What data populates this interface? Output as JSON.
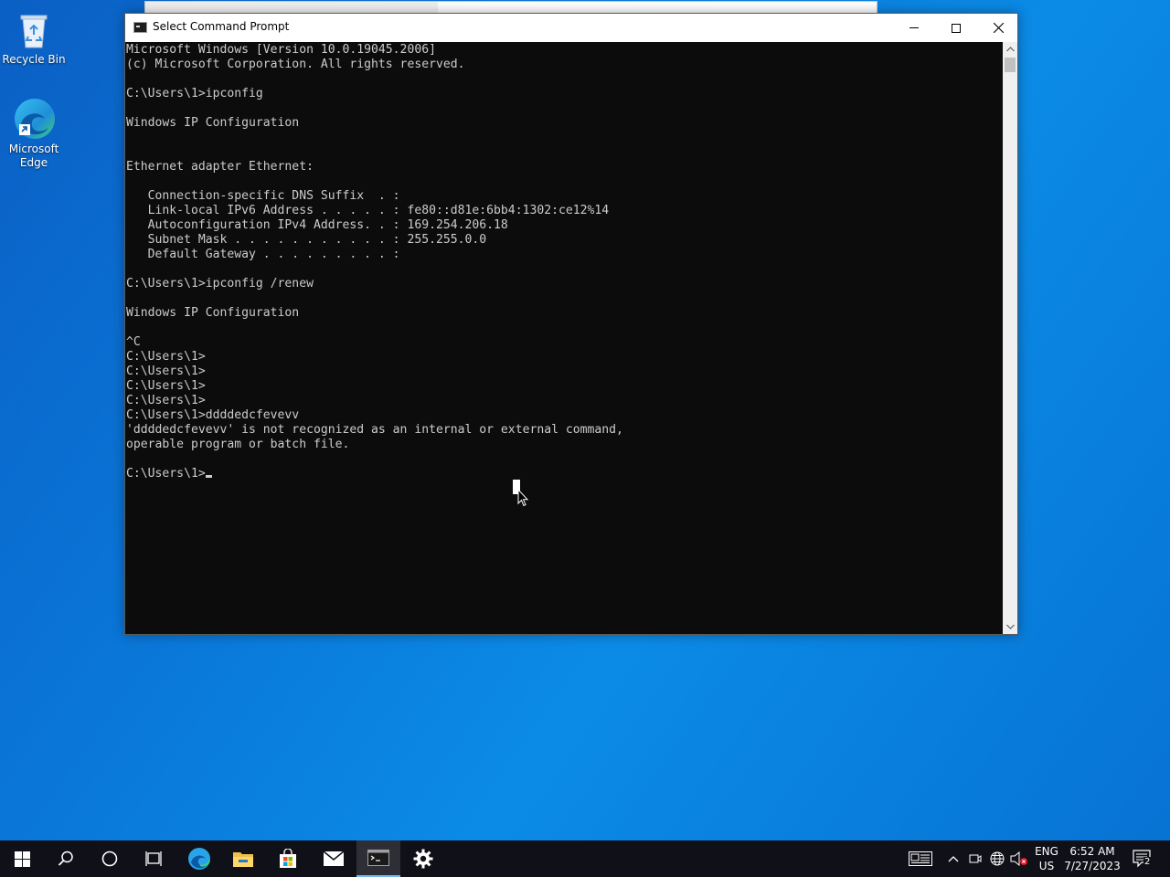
{
  "desktop": {
    "icons": [
      {
        "label": "Recycle Bin"
      },
      {
        "label": "Microsoft\nEdge"
      }
    ]
  },
  "window": {
    "title": "Select Command Prompt"
  },
  "console": {
    "lines": [
      "Microsoft Windows [Version 10.0.19045.2006]",
      "(c) Microsoft Corporation. All rights reserved.",
      "",
      "C:\\Users\\1>ipconfig",
      "",
      "Windows IP Configuration",
      "",
      "",
      "Ethernet adapter Ethernet:",
      "",
      "   Connection-specific DNS Suffix  . :",
      "   Link-local IPv6 Address . . . . . : fe80::d81e:6bb4:1302:ce12%14",
      "   Autoconfiguration IPv4 Address. . : 169.254.206.18",
      "   Subnet Mask . . . . . . . . . . . : 255.255.0.0",
      "   Default Gateway . . . . . . . . . :",
      "",
      "C:\\Users\\1>ipconfig /renew",
      "",
      "Windows IP Configuration",
      "",
      "^C",
      "C:\\Users\\1>",
      "C:\\Users\\1>",
      "C:\\Users\\1>",
      "C:\\Users\\1>",
      "C:\\Users\\1>ddddedcfevevv",
      "'ddddedcfevevv' is not recognized as an internal or external command,",
      "operable program or batch file.",
      "",
      "C:\\Users\\1>"
    ]
  },
  "taskbar": {
    "tray": {
      "lang_top": "ENG",
      "lang_bottom": "US",
      "time": "6:52 AM",
      "date": "7/27/2023",
      "notification_count": "2"
    }
  },
  "colors": {
    "console_bg": "#0c0c0c",
    "console_fg": "#cccccc",
    "taskbar_bg": "#101018",
    "desktop_accent": "#0a78d9"
  }
}
